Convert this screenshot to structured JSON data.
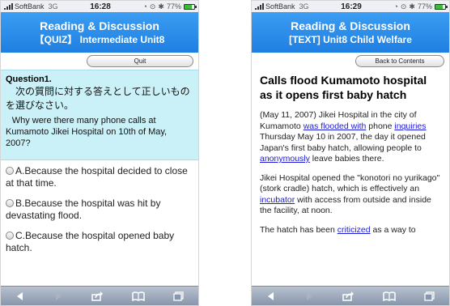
{
  "left": {
    "status": {
      "carrier": "SoftBank",
      "network": "3G",
      "time": "16:28",
      "battery": "77%",
      "battery_level": 0.77
    },
    "header": {
      "title": "Reading & Discussion",
      "subtitle": "【QUIZ】 Intermediate Unit8"
    },
    "button_label": "Quit",
    "question": {
      "title": "Question1.",
      "instruction": "次の質問に対する答えとして正しいものを選びなさい。",
      "text": "Why were there many phone calls at Kumamoto Jikei Hospital on 10th of May, 2007?"
    },
    "options": [
      "A.Because the hospital decided to close at that time.",
      "B.Because the hospital was hit by devastating flood.",
      "C.Because the hospital opened baby hatch."
    ]
  },
  "right": {
    "status": {
      "carrier": "SoftBank",
      "network": "3G",
      "time": "16:29",
      "battery": "77%",
      "battery_level": 0.77
    },
    "header": {
      "title": "Reading & Discussion",
      "subtitle": "[TEXT] Unit8 Child Welfare"
    },
    "button_label": "Back to Contents",
    "article": {
      "title": "Calls flood Kumamoto hospital as it opens first baby hatch",
      "p1": {
        "a": "(May 11, 2007) Jikei Hospital in the city of Kumamoto ",
        "link1": "was flooded with",
        "b": " phone ",
        "link2": "inquiries",
        "c": " Thursday May 10 in 2007, the day it opened Japan's first baby hatch, allowing people to ",
        "link3": "anonymously",
        "d": " leave babies there."
      },
      "p2": {
        "a": "Jikei Hospital opened the \"konotori no yurikago\" (stork cradle) hatch, which is effectively an ",
        "link1": "incubator",
        "b": " with access from outside and inside the facility, at noon."
      },
      "p3": {
        "a": "The hatch has been ",
        "link1": "criticized",
        "b": " as a way to"
      }
    }
  },
  "colors": {
    "header": "#1f7fe2",
    "question_bg": "#c9f1f7",
    "link": "#1a1ad8",
    "toolbar": "#8796ab"
  },
  "toolbar_icons": [
    "back-arrow-icon",
    "forward-arrow-icon",
    "share-icon",
    "bookmarks-icon",
    "pages-icon"
  ]
}
